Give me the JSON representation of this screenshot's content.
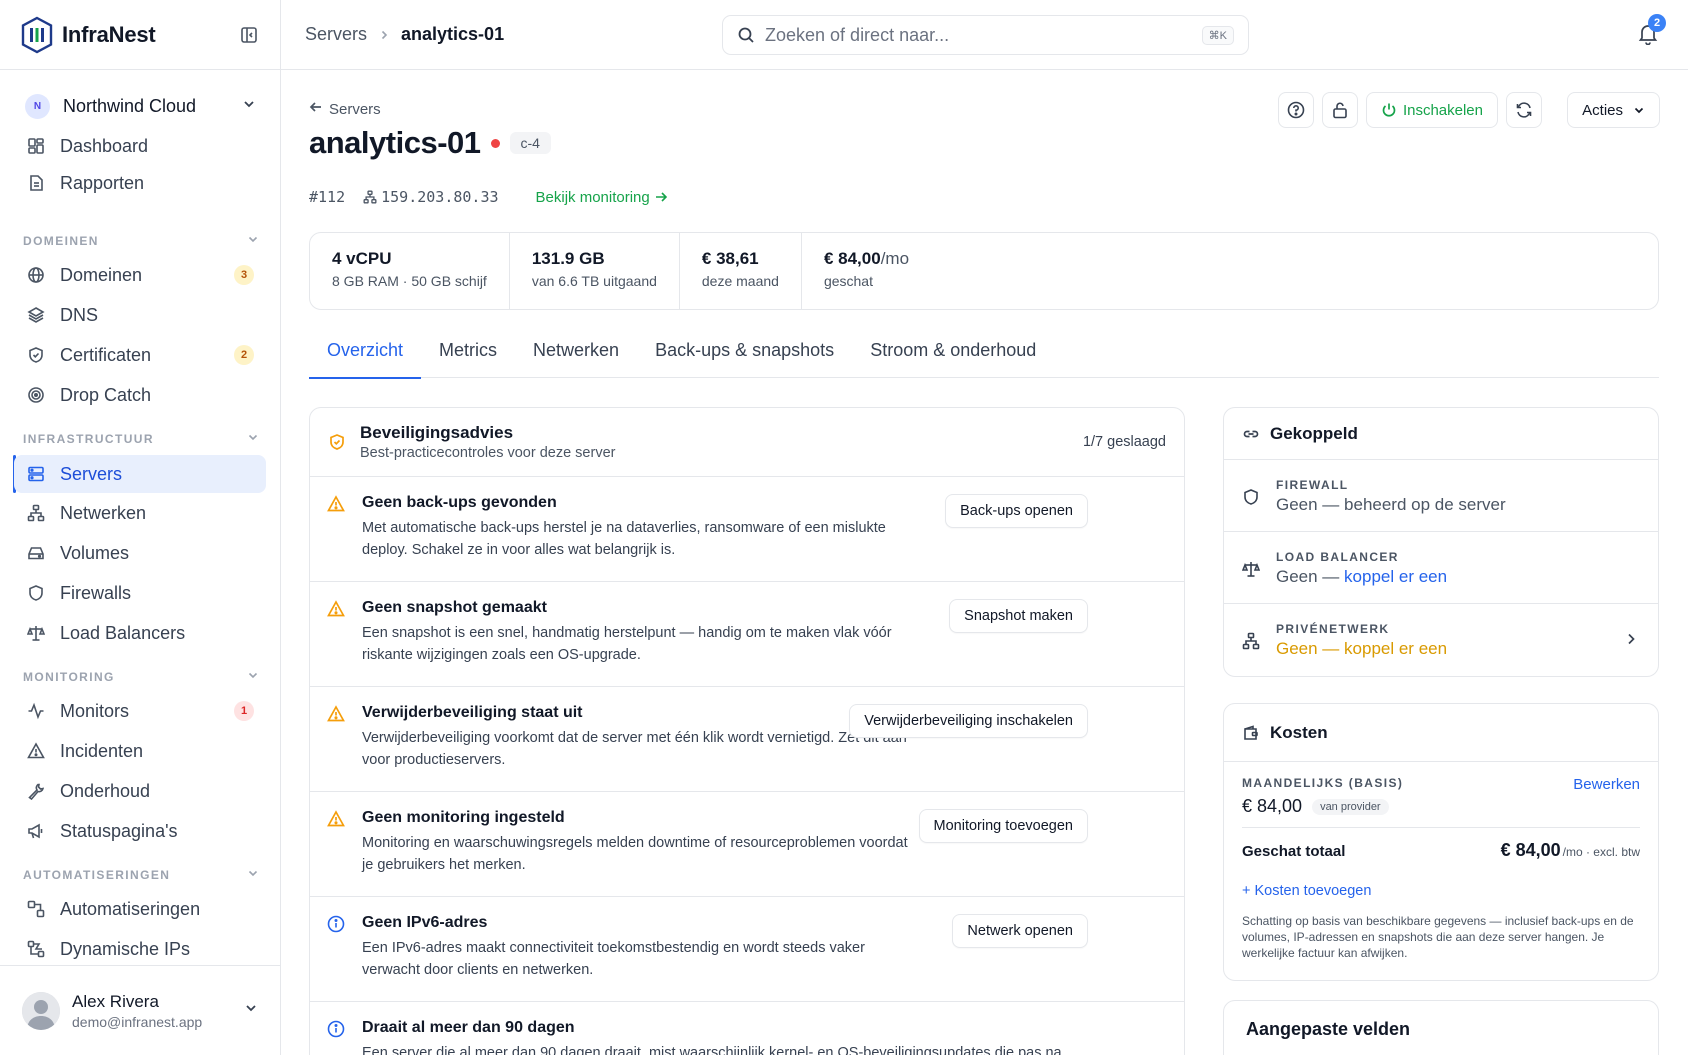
{
  "app": {
    "name": "InfraNest"
  },
  "org": {
    "initial": "N",
    "name": "Northwind Cloud"
  },
  "sidebar": {
    "top_items": [
      {
        "label": "Dashboard",
        "icon": "dashboard-icon"
      },
      {
        "label": "Rapporten",
        "icon": "report-icon"
      }
    ],
    "sections": [
      {
        "title": "DOMEINEN",
        "items": [
          {
            "label": "Domeinen",
            "icon": "globe-icon",
            "badge": "3"
          },
          {
            "label": "DNS",
            "icon": "layers-icon"
          },
          {
            "label": "Certificaten",
            "icon": "shield-check-icon",
            "badge": "2"
          },
          {
            "label": "Drop Catch",
            "icon": "target-icon"
          }
        ]
      },
      {
        "title": "INFRASTRUCTUUR",
        "items": [
          {
            "label": "Servers",
            "icon": "server-icon",
            "active": true
          },
          {
            "label": "Netwerken",
            "icon": "network-icon"
          },
          {
            "label": "Volumes",
            "icon": "drive-icon"
          },
          {
            "label": "Firewalls",
            "icon": "shield-icon"
          },
          {
            "label": "Load Balancers",
            "icon": "scale-icon"
          }
        ]
      },
      {
        "title": "MONITORING",
        "items": [
          {
            "label": "Monitors",
            "icon": "activity-icon",
            "badge": "1"
          },
          {
            "label": "Incidenten",
            "icon": "warning-icon"
          },
          {
            "label": "Onderhoud",
            "icon": "wrench-icon"
          },
          {
            "label": "Statuspagina's",
            "icon": "megaphone-icon"
          }
        ]
      },
      {
        "title": "AUTOMATISERINGEN",
        "items": [
          {
            "label": "Automatiseringen",
            "icon": "workflow-icon"
          },
          {
            "label": "Dynamische IPs",
            "icon": "dynamic-ip-icon"
          }
        ]
      }
    ]
  },
  "user": {
    "name": "Alex Rivera",
    "email": "demo@infranest.app"
  },
  "topbar": {
    "breadcrumb_parent": "Servers",
    "breadcrumb_current": "analytics-01",
    "search_placeholder": "Zoeken of direct naar...",
    "search_shortcut": "⌘K",
    "notification_count": "2"
  },
  "server": {
    "back_label": "Servers",
    "name": "analytics-01",
    "status_color": "#ef4444",
    "type": "c-4",
    "id": "#112",
    "ip": "159.203.80.33",
    "monitoring_link": "Bekijk monitoring"
  },
  "actions": {
    "power_label": "Inschakelen",
    "menu_label": "Acties"
  },
  "stats": [
    {
      "main": "4 vCPU",
      "unit": "",
      "sub": "8 GB RAM · 50 GB schijf"
    },
    {
      "main": "131.9 GB",
      "unit": "",
      "sub": "van 6.6 TB uitgaand"
    },
    {
      "main": "€ 38,61",
      "unit": "",
      "sub": "deze maand"
    },
    {
      "main": "€ 84,00",
      "unit": "/mo",
      "sub": "geschat"
    }
  ],
  "tabs": [
    {
      "label": "Overzicht",
      "active": true
    },
    {
      "label": "Metrics"
    },
    {
      "label": "Netwerken"
    },
    {
      "label": "Back-ups & snapshots"
    },
    {
      "label": "Stroom & onderhoud"
    }
  ],
  "security": {
    "title": "Beveiligingsadvies",
    "subtitle": "Best-practicecontroles voor deze server",
    "count": "1/7 geslaagd",
    "issues": [
      {
        "level": "warning",
        "title": "Geen back-ups gevonden",
        "desc": "Met automatische back-ups herstel je na dataverlies, ransomware of een mislukte deploy. Schakel ze in voor alles wat belangrijk is.",
        "button": "Back-ups openen"
      },
      {
        "level": "warning",
        "title": "Geen snapshot gemaakt",
        "desc": "Een snapshot is een snel, handmatig herstelpunt — handig om te maken vlak vóór riskante wijzigingen zoals een OS-upgrade.",
        "button": "Snapshot maken"
      },
      {
        "level": "warning",
        "title": "Verwijderbeveiliging staat uit",
        "desc": "Verwijderbeveiliging voorkomt dat de server met één klik wordt vernietigd. Zet dit aan voor productieservers.",
        "button": "Verwijderbeveiliging inschakelen"
      },
      {
        "level": "warning",
        "title": "Geen monitoring ingesteld",
        "desc": "Monitoring en waarschuwingsregels melden downtime of resourceproblemen voordat je gebruikers het merken.",
        "button": "Monitoring toevoegen"
      },
      {
        "level": "info",
        "title": "Geen IPv6-adres",
        "desc": "Een IPv6-adres maakt connectiviteit toekomstbestendig en wordt steeds vaker verwacht door clients en netwerken.",
        "button": "Netwerk openen"
      },
      {
        "level": "info",
        "title": "Draait al meer dan 90 dagen",
        "desc": "Een server die al meer dan 90 dagen draait, mist waarschijnlijk kernel- en OS-beveiligingsupdates die pas na",
        "button": ""
      }
    ]
  },
  "linked": {
    "title": "Gekoppeld",
    "firewall": {
      "label": "FIREWALL",
      "value": "Geen — beheerd op de server"
    },
    "load_balancer": {
      "label": "LOAD BALANCER",
      "prefix": "Geen — ",
      "link": "koppel er een"
    },
    "private_network": {
      "label": "PRIVÉNETWERK",
      "value": "Geen — koppel er een"
    }
  },
  "costs": {
    "title": "Kosten",
    "monthly_label": "MAANDELIJKS (BASIS)",
    "edit_label": "Bewerken",
    "monthly_amount": "€ 84,00",
    "provider_pill": "van provider",
    "total_label": "Geschat totaal",
    "total_value": "€ 84,00",
    "total_suffix": "/mo · excl. btw",
    "add_label": "+ Kosten toevoegen",
    "note": "Schatting op basis van beschikbare gegevens — inclusief back-ups en de volumes, IP-adressen en snapshots die aan deze server hangen. Je werkelijke factuur kan afwijken."
  },
  "custom_fields": {
    "title": "Aangepaste velden"
  },
  "colors": {
    "accent": "#2563eb",
    "success": "#16a34a",
    "warning": "#f59e0b",
    "danger": "#ef4444"
  }
}
